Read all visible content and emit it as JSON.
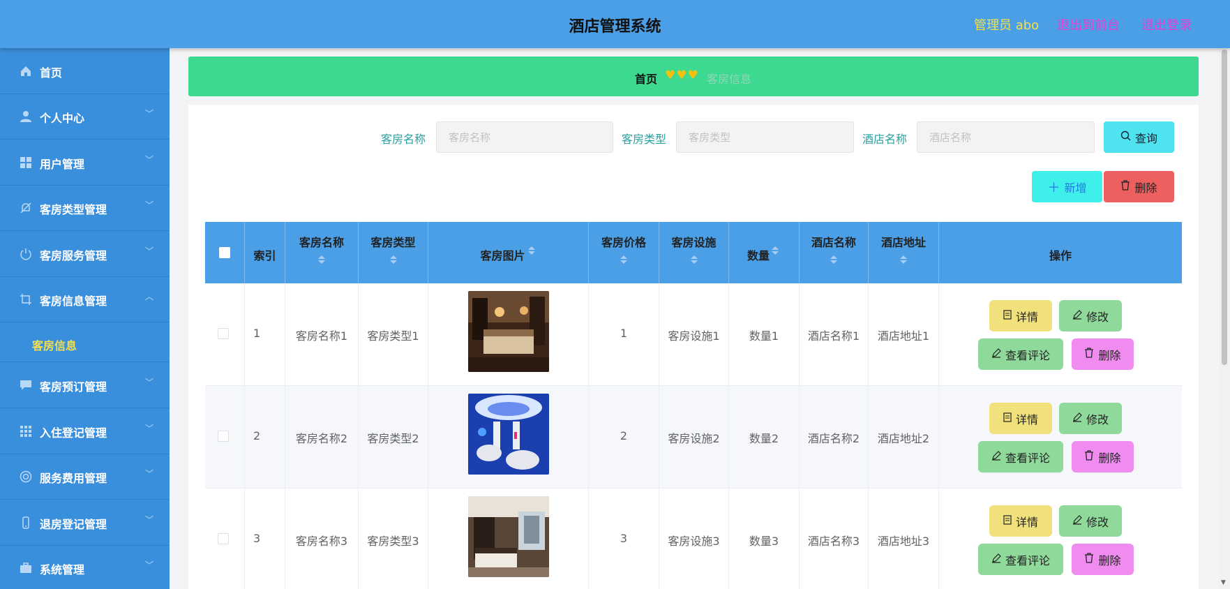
{
  "header": {
    "title": "酒店管理系统",
    "admin": "管理员 abo",
    "exit_front": "退出到前台",
    "logout": "退出登录"
  },
  "sidebar": {
    "items": [
      {
        "label": "首页",
        "icon": "home-icon"
      },
      {
        "label": "个人中心",
        "icon": "user-icon"
      },
      {
        "label": "用户管理",
        "icon": "grid-icon"
      },
      {
        "label": "客房类型管理",
        "icon": "bell-off-icon"
      },
      {
        "label": "客房服务管理",
        "icon": "power-icon"
      },
      {
        "label": "客房信息管理",
        "icon": "crop-icon",
        "sub": "客房信息"
      },
      {
        "label": "客房预订管理",
        "icon": "chat-icon"
      },
      {
        "label": "入住登记管理",
        "icon": "apps-icon"
      },
      {
        "label": "服务费用管理",
        "icon": "lifebuoy-icon"
      },
      {
        "label": "退房登记管理",
        "icon": "phone-icon"
      },
      {
        "label": "系统管理",
        "icon": "briefcase-icon"
      }
    ]
  },
  "breadcrumb": {
    "home": "首页",
    "hearts": "♥♥♥",
    "current": "客房信息"
  },
  "search": {
    "room_name_label": "客房名称",
    "room_name_placeholder": "客房名称",
    "room_type_label": "客房类型",
    "room_type_placeholder": "客房类型",
    "hotel_name_label": "酒店名称",
    "hotel_name_placeholder": "酒店名称",
    "query_label": "查询"
  },
  "actions": {
    "add_label": "新增",
    "delete_label": "删除"
  },
  "table": {
    "headers": {
      "index": "索引",
      "room_name": "客房名称",
      "room_type": "客房类型",
      "room_image": "客房图片",
      "price": "客房价格",
      "facilities": "客房设施",
      "quantity": "数量",
      "hotel_name": "酒店名称",
      "hotel_address": "酒店地址",
      "ops": "操作"
    },
    "rows": [
      {
        "index": "1",
        "room_name": "客房名称1",
        "room_type": "客房类型1",
        "price": "1",
        "facilities": "客房设施1",
        "quantity": "数量1",
        "hotel_name": "酒店名称1",
        "hotel_address": "酒店地址1"
      },
      {
        "index": "2",
        "room_name": "客房名称2",
        "room_type": "客房类型2",
        "price": "2",
        "facilities": "客房设施2",
        "quantity": "数量2",
        "hotel_name": "酒店名称2",
        "hotel_address": "酒店地址2"
      },
      {
        "index": "3",
        "room_name": "客房名称3",
        "room_type": "客房类型3",
        "price": "3",
        "facilities": "客房设施3",
        "quantity": "数量3",
        "hotel_name": "酒店名称3",
        "hotel_address": "酒店地址3"
      }
    ],
    "ops": {
      "detail": "详情",
      "edit": "修改",
      "review": "查看评论",
      "delete": "删除"
    }
  },
  "colors": {
    "header": "#4a9fe6",
    "sidebar": "#3a8fdc",
    "breadcrumb": "#3ed991",
    "accent_yellow": "#f4e04d",
    "accent_pink": "#e83fd1"
  }
}
